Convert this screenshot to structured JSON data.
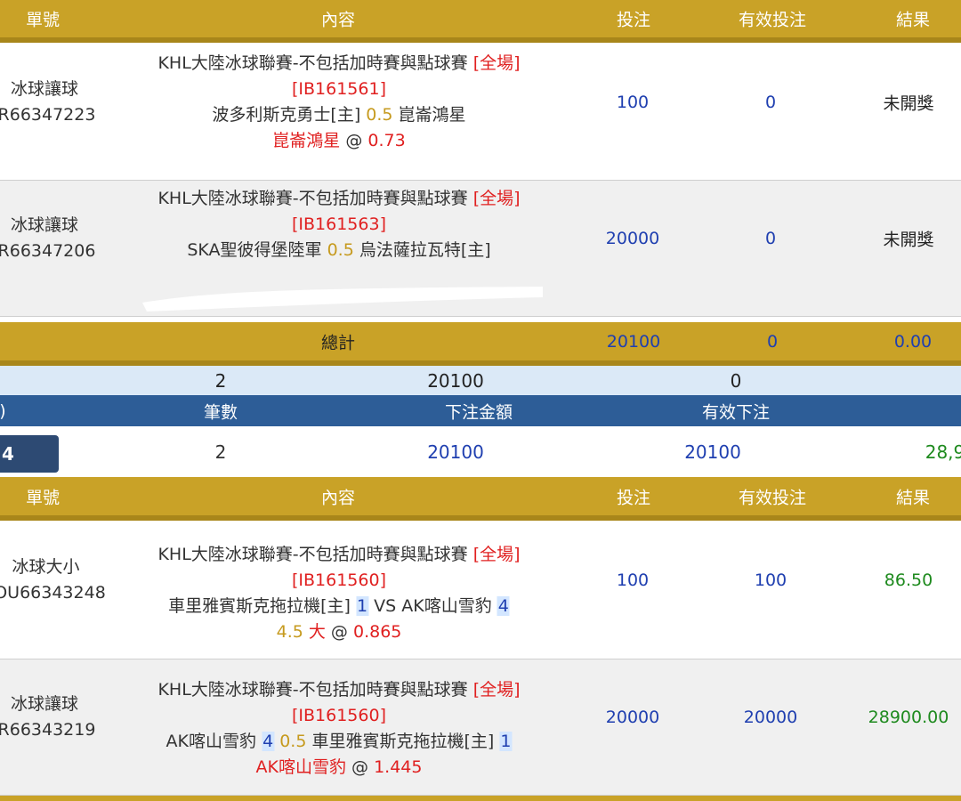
{
  "headers": {
    "order_no": "單號",
    "content": "內容",
    "stake": "投注",
    "valid_stake": "有效投注",
    "result": "結果"
  },
  "group1": {
    "rows": [
      {
        "type": "冰球讓球",
        "order": "R66347223",
        "league": "KHL大陸冰球聯賽-不包括加時賽與點球賽",
        "period": "[全場]",
        "match_id": "[IB161561]",
        "home": "波多利斯克勇士[主]",
        "handicap": "0.5",
        "away": "崑崙鴻星",
        "pick": "崑崙鴻星",
        "at": "@",
        "odds": "0.73",
        "stake": "100",
        "valid": "0",
        "result": "未開獎"
      },
      {
        "type": "冰球讓球",
        "order": "R66347206",
        "league": "KHL大陸冰球聯賽-不包括加時賽與點球賽",
        "period": "[全場]",
        "match_id": "[IB161563]",
        "home": "SKA聖彼得堡陸軍",
        "handicap": "0.5",
        "away": "烏法薩拉瓦特[主]",
        "stake": "20000",
        "valid": "0",
        "result": "未開獎"
      }
    ],
    "total": {
      "label": "總計",
      "stake": "20100",
      "valid": "0",
      "result": "0.00"
    }
  },
  "summary_light": {
    "count": "2",
    "amount": "20100",
    "valid": "0"
  },
  "summary_header": {
    "left_cut": ")",
    "count_label": "筆數",
    "amount_label": "下注金額",
    "valid_label": "有效下注"
  },
  "summary_row": {
    "pill_text": "4",
    "count": "2",
    "amount": "20100",
    "valid": "20100",
    "win_cut": "28,9"
  },
  "group2": {
    "rows": [
      {
        "type": "冰球大小",
        "order": "OU66343248",
        "league": "KHL大陸冰球聯賽-不包括加時賽與點球賽",
        "period": "[全場]",
        "match_id": "[IB161560]",
        "home": "車里雅賓斯克拖拉機[主]",
        "home_score": "1",
        "vs": "VS",
        "away": "AK喀山雪豹",
        "away_score": "4",
        "line": "4.5",
        "pick": "大",
        "at": "@",
        "odds": "0.865",
        "stake": "100",
        "valid": "100",
        "result": "86.50"
      },
      {
        "type": "冰球讓球",
        "order": "R66343219",
        "league": "KHL大陸冰球聯賽-不包括加時賽與點球賽",
        "period": "[全場]",
        "match_id": "[IB161560]",
        "home": "AK喀山雪豹",
        "home_score": "4",
        "handicap": "0.5",
        "away": "車里雅賓斯克拖拉機[主]",
        "away_score": "1",
        "pick": "AK喀山雪豹",
        "at": "@",
        "odds": "1.445",
        "stake": "20000",
        "valid": "20000",
        "result": "28900.00"
      }
    ]
  }
}
